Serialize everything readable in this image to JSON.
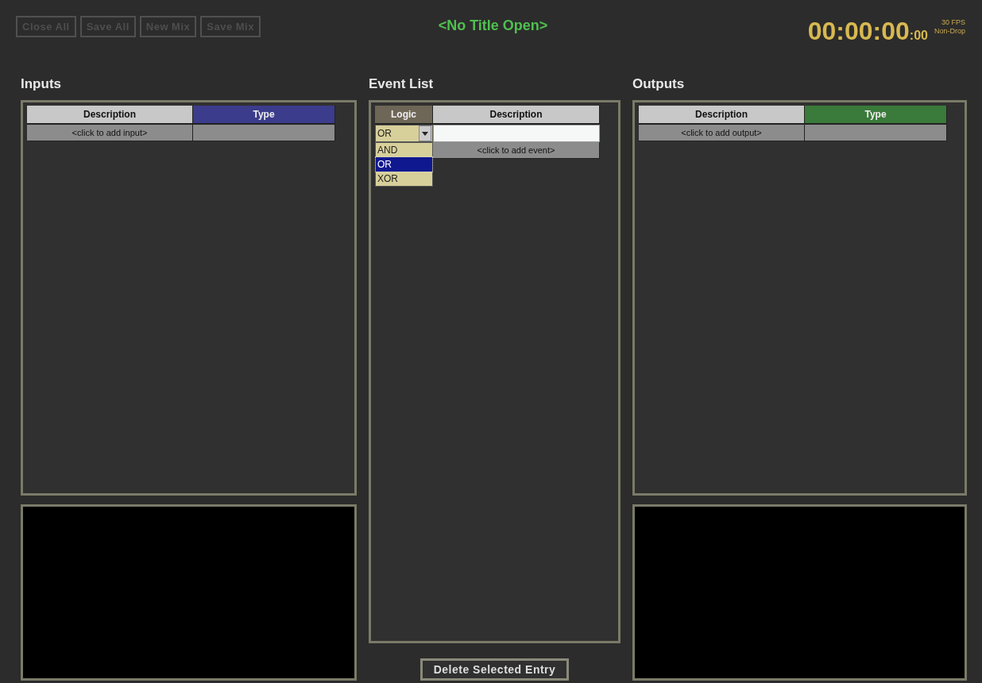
{
  "toolbar": {
    "buttons": [
      {
        "label": "Close All",
        "disabled": true
      },
      {
        "label": "Save All",
        "disabled": true
      },
      {
        "label": "New Mix",
        "disabled": true
      },
      {
        "label": "Save Mix",
        "disabled": true
      }
    ]
  },
  "title": "<No Title Open>",
  "timecode": {
    "main": "00:00:00",
    "frames": ":00",
    "fps": "30 FPS",
    "mode": "Non-Drop"
  },
  "inputs": {
    "heading": "Inputs",
    "columns": [
      {
        "label": "Description",
        "color": "#c8c8c8"
      },
      {
        "label": "Type",
        "color": "#3c3c8c"
      }
    ],
    "add_row": "<click to add input>"
  },
  "event_list": {
    "heading": "Event List",
    "columns": [
      {
        "label": "Logic",
        "color": "#6e6656"
      },
      {
        "label": "Description",
        "color": "#c8c8c8"
      }
    ],
    "logic_select": {
      "value": "OR",
      "expanded": true,
      "options": [
        {
          "label": "AND",
          "selected": false
        },
        {
          "label": "OR",
          "selected": true
        },
        {
          "label": "XOR",
          "selected": false
        }
      ]
    },
    "add_row": "<click to add event>"
  },
  "outputs": {
    "heading": "Outputs",
    "columns": [
      {
        "label": "Description",
        "color": "#c8c8c8"
      },
      {
        "label": "Type",
        "color": "#3a7a3a"
      }
    ],
    "add_row": "<click to add output>"
  },
  "delete_button": {
    "label": "Delete Selected Entry",
    "disabled": false
  }
}
